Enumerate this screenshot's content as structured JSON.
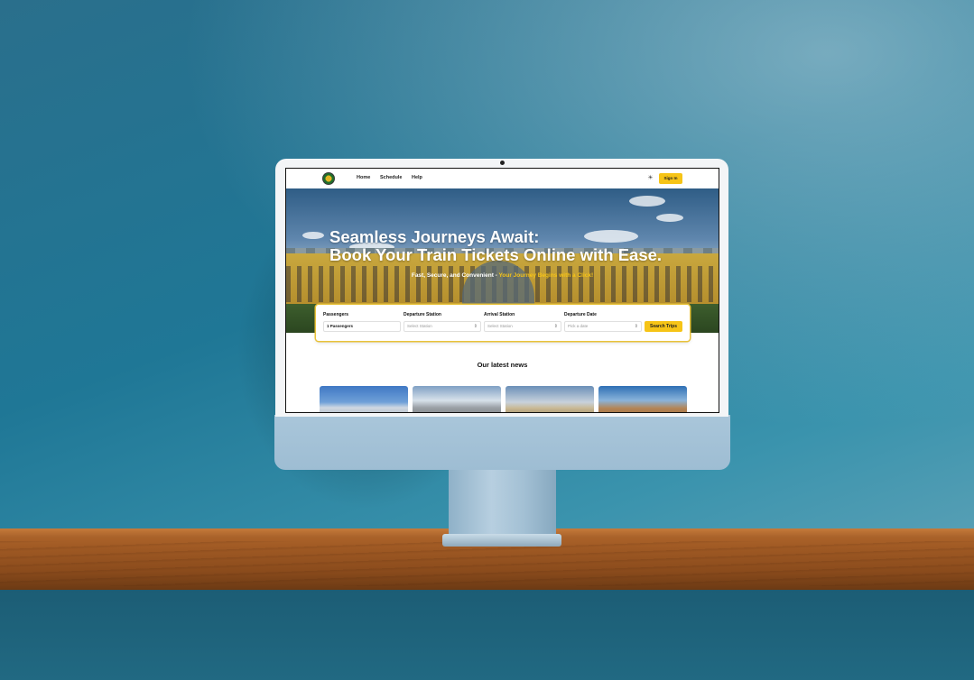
{
  "nav": {
    "links": [
      "Home",
      "Schedule",
      "Help"
    ],
    "theme_toggle_icon": "sun-icon",
    "signin_label": "Sign In"
  },
  "hero": {
    "title_line1": "Seamless Journeys Await:",
    "title_line2": "Book Your Train Tickets Online with Ease.",
    "subtitle_plain": "Fast, Secure, and Convenient - ",
    "subtitle_highlight": "Your Journey Begins with a Click!"
  },
  "search": {
    "passengers_label": "Passengers",
    "passengers_value": "1 Passengers",
    "departure_label": "Departure Station",
    "departure_placeholder": "Select Station",
    "arrival_label": "Arrival Station",
    "arrival_placeholder": "Select Station",
    "date_label": "Departure Date",
    "date_placeholder": "Pick a date",
    "button_label": "Search Trips"
  },
  "news": {
    "title": "Our latest news"
  },
  "colors": {
    "accent": "#f6c417",
    "wall": "#1f7796",
    "shelf": "#a05a24"
  }
}
